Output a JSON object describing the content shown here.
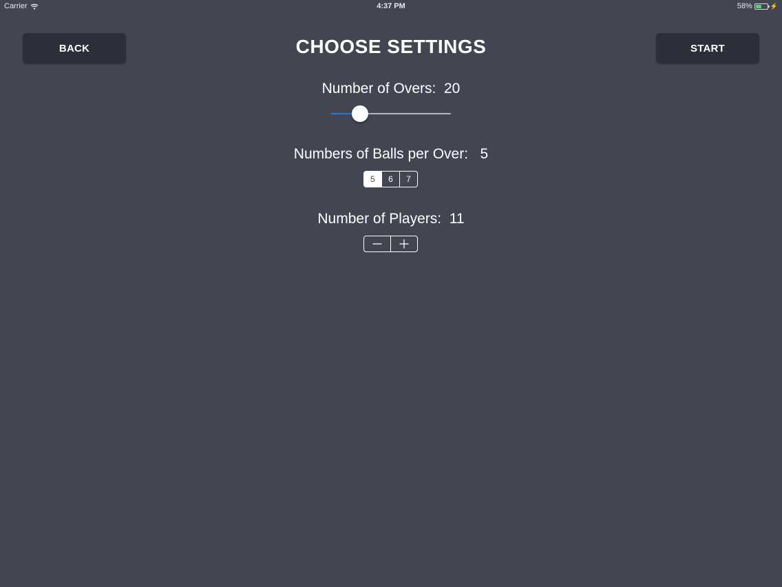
{
  "status_bar": {
    "carrier": "Carrier",
    "time": "4:37 PM",
    "battery_text": "58%",
    "battery_level": 0.58
  },
  "header": {
    "back_label": "BACK",
    "title": "CHOOSE SETTINGS",
    "start_label": "START"
  },
  "settings": {
    "overs": {
      "label": "Number of Overs:  20",
      "value": 20,
      "slider_fraction": 0.24
    },
    "balls": {
      "label": "Numbers of Balls per Over:   5",
      "options": [
        "5",
        "6",
        "7"
      ],
      "selected": "5"
    },
    "players": {
      "label": "Number of Players:  11",
      "value": 11
    }
  },
  "colors": {
    "background": "#434551",
    "button_background": "#2d2f38",
    "slider_accent": "#1a7cf5",
    "battery_green": "#4cd964"
  },
  "icons": {
    "status": [
      "wifi-icon",
      "battery-icon",
      "bolt-icon"
    ],
    "stepper": [
      "minus-icon",
      "plus-icon"
    ]
  }
}
